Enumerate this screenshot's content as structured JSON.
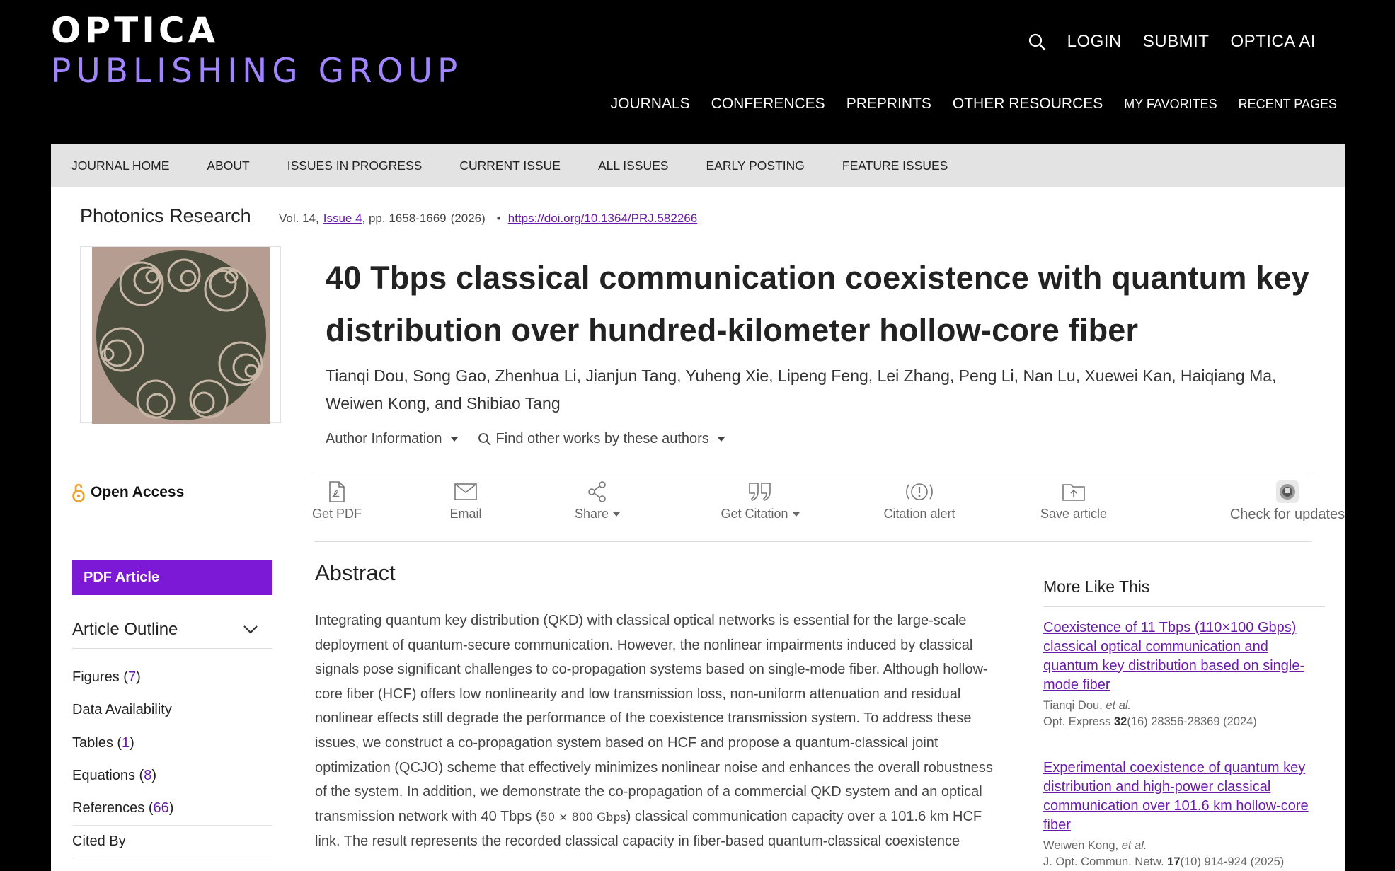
{
  "header": {
    "logo_top": "OPTICA",
    "logo_bottom": "PUBLISHING GROUP",
    "util_links": [
      "LOGIN",
      "SUBMIT",
      "OPTICA AI"
    ],
    "main_nav": [
      "JOURNALS",
      "CONFERENCES",
      "PREPRINTS",
      "OTHER RESOURCES"
    ],
    "main_nav_small": [
      "MY FAVORITES",
      "RECENT PAGES"
    ],
    "search_icon": "search-icon"
  },
  "journal_nav": [
    "JOURNAL HOME",
    "ABOUT",
    "ISSUES IN PROGRESS",
    "CURRENT ISSUE",
    "ALL ISSUES",
    "EARLY POSTING",
    "FEATURE ISSUES"
  ],
  "article": {
    "journal": "Photonics Research",
    "vol": "Vol. 14,",
    "issue": "Issue 4",
    "pages": ", pp. 1658-1669",
    "year": "(2026)",
    "bullet": "•",
    "doi": "https://doi.org/10.1364/PRJ.582266",
    "title": "40 Tbps classical communication coexistence with quantum key distribution over hundred-kilometer hollow-core fiber",
    "authors": "Tianqi Dou, Song Gao, Zhenhua Li, Jianjun Tang, Yuheng Xie, Lipeng Feng, Lei Zhang, Peng Li, Nan Lu, Xuewei Kan, Haiqiang Ma, Weiwen Kong, and Shibiao Tang",
    "author_info": "Author Information",
    "find_other": "Find other works by these authors"
  },
  "actions": {
    "get_pdf": "Get PDF",
    "email": "Email",
    "share": "Share",
    "get_citation": "Get Citation",
    "citation_alert": "Citation alert",
    "save_article": "Save article",
    "check_updates": "Check for updates"
  },
  "sidebar": {
    "open_access": "Open Access",
    "pdf_article": "PDF Article",
    "outline_title": "Article Outline",
    "outline": [
      {
        "label": "Figures",
        "count": "7"
      },
      {
        "label": "Data Availability",
        "count": ""
      },
      {
        "label": "Tables",
        "count": "1"
      },
      {
        "label": "Equations",
        "count": "8"
      },
      {
        "label": "References",
        "count": "66"
      },
      {
        "label": "Cited By",
        "count": ""
      }
    ]
  },
  "abstract": {
    "heading": "Abstract",
    "text_before": "Integrating quantum key distribution (QKD) with classical optical networks is essential for the large-scale deployment of quantum-secure communication. However, the nonlinear impairments induced by classical signals pose significant challenges to co-propagation systems based on single-mode fiber. Although hollow-core fiber (HCF) offers low nonlinearity and low transmission loss, non-uniform attenuation and residual nonlinear effects still degrade the performance of the coexistence transmission system. To address these issues, we construct a co-propagation system based on HCF and propose a quantum-classical joint optimization (QCJO) scheme that effectively minimizes nonlinear noise and enhances the overall robustness of the system. In addition, we demonstrate the co-propagation of a commercial QKD system and an optical transmission network with 40 Tbps (",
    "math": "50 × 800 Gbps",
    "text_after": ") classical communication capacity over a 101.6 km HCF link. The result represents the recorded classical capacity in fiber-based quantum-classical coexistence"
  },
  "more_like_this": {
    "heading": "More Like This",
    "items": [
      {
        "title": "Coexistence of 11 Tbps (110×100 Gbps) classical optical communication and quantum key distribution based on single-mode fiber",
        "authors": "Tianqi Dou,",
        "etal": "et al.",
        "journal": "Opt. Express",
        "vol": "32",
        "rest": "(16) 28356-28369 (2024)"
      },
      {
        "title": "Experimental coexistence of quantum key distribution and high-power classical communication over 101.6 km hollow-core fiber",
        "authors": "Weiwen Kong,",
        "etal": "et al.",
        "journal": "J. Opt. Commun. Netw.",
        "vol": "17",
        "rest": "(10) 914-924 (2025)"
      }
    ]
  },
  "colors": {
    "accent_purple": "#7b19d6",
    "link_purple": "#6a1aa8",
    "logo_purple": "#a184ff",
    "open_access_orange": "#f0a030"
  }
}
